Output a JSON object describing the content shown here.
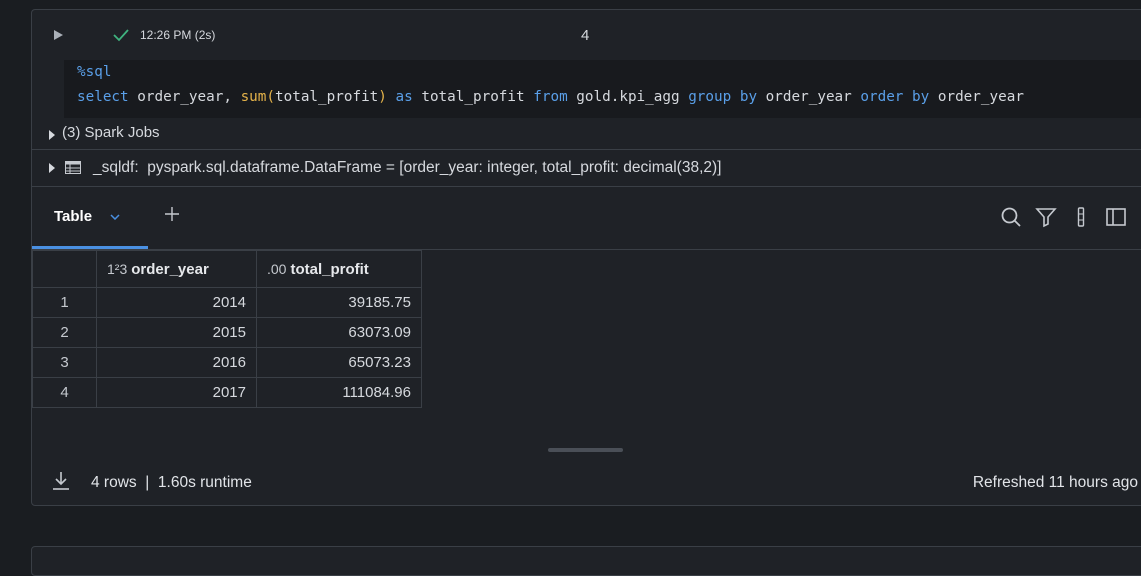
{
  "cell": {
    "exec_time": "12:26 PM (2s)",
    "cell_number": "4",
    "code": {
      "line1": "%sql",
      "line2": {
        "t1": "select",
        "t2": " order_year, ",
        "t3": "sum",
        "t4": "(",
        "t5": "total_profit",
        "t6": ")",
        "t7": " ",
        "t8": "as",
        "t9": " total_profit ",
        "t10": "from",
        "t11": " gold.kpi_agg ",
        "t12": "group by",
        "t13": " order_year ",
        "t14": "order by",
        "t15": " order_year"
      }
    },
    "spark_jobs": "(3) Spark Jobs",
    "dataframe_line": "_sqldf:  pyspark.sql.dataframe.DataFrame = [order_year: integer, total_profit: decimal(38,2)]"
  },
  "results": {
    "tab_label": "Table",
    "columns": [
      {
        "type_icon": "1²3",
        "label": "order_year"
      },
      {
        "type_icon": ".00",
        "label": "total_profit"
      }
    ],
    "rows": [
      {
        "index": "1",
        "order_year": "2014",
        "total_profit": "39185.75"
      },
      {
        "index": "2",
        "order_year": "2015",
        "total_profit": "63073.09"
      },
      {
        "index": "3",
        "order_year": "2016",
        "total_profit": "65073.23"
      },
      {
        "index": "4",
        "order_year": "2017",
        "total_profit": "111084.96"
      }
    ],
    "footer": {
      "rows_info": "4 rows  |  1.60s runtime",
      "refreshed": "Refreshed 11 hours ago"
    }
  },
  "colors": {
    "accent": "#4a90e2",
    "success": "#3fb37f",
    "keyword": "#5a9fe8",
    "function": "#e5b34a"
  },
  "icons": [
    "play-icon",
    "check-icon",
    "caret-right-icon",
    "table-icon",
    "chevron-down-icon",
    "plus-icon",
    "search-icon",
    "filter-icon",
    "kebab-icon",
    "sidebar-panel-icon",
    "download-icon"
  ]
}
